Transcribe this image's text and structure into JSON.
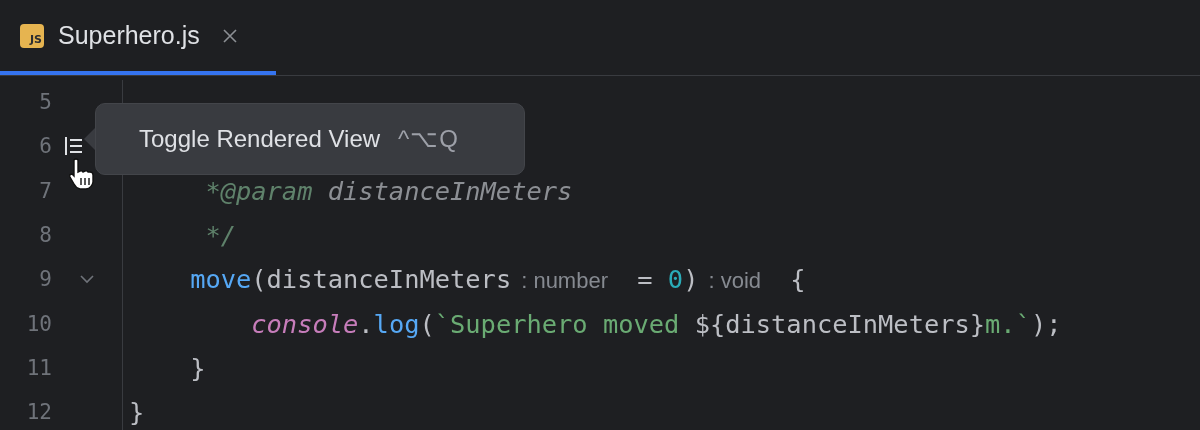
{
  "tab": {
    "icon_text": "JS",
    "title": "Superhero.js",
    "selected": true
  },
  "lines": [
    {
      "number": "5",
      "kind": "plain"
    },
    {
      "number": "6",
      "kind": "render-toggle"
    },
    {
      "number": "7",
      "kind": "plain",
      "tokens": [
        {
          "text": "     *@param",
          "kind": "doc-tag"
        },
        {
          "text": " distanceInMeters",
          "kind": "doc-text"
        }
      ]
    },
    {
      "number": "8",
      "kind": "plain",
      "tokens": [
        {
          "text": "     */",
          "kind": "doc-tag"
        }
      ]
    },
    {
      "number": "9",
      "kind": "fold",
      "tokens": [
        {
          "text": "    move",
          "kind": "function"
        },
        {
          "text": "(distanceInMeters",
          "kind": "plain"
        },
        {
          "text": ": number",
          "kind": "hint"
        },
        {
          "text": " = ",
          "kind": "plain"
        },
        {
          "text": "0",
          "kind": "number"
        },
        {
          "text": ")",
          "kind": "plain"
        },
        {
          "text": ": void",
          "kind": "hint"
        },
        {
          "text": " {",
          "kind": "plain"
        }
      ]
    },
    {
      "number": "10",
      "kind": "plain",
      "tokens": [
        {
          "text": "        console",
          "kind": "object"
        },
        {
          "text": ".",
          "kind": "plain"
        },
        {
          "text": "log",
          "kind": "function"
        },
        {
          "text": "(",
          "kind": "plain"
        },
        {
          "text": "`Superhero moved ",
          "kind": "string"
        },
        {
          "text": "${distanceInMeters}",
          "kind": "plain"
        },
        {
          "text": "m.`",
          "kind": "string"
        },
        {
          "text": ");",
          "kind": "plain"
        }
      ]
    },
    {
      "number": "11",
      "kind": "plain",
      "tokens": [
        {
          "text": "    }",
          "kind": "plain"
        }
      ]
    },
    {
      "number": "12",
      "kind": "plain",
      "tokens": [
        {
          "text": "}",
          "kind": "plain"
        }
      ]
    }
  ],
  "tooltip": {
    "label": "Toggle Rendered View",
    "shortcut": "^⌥Q"
  }
}
